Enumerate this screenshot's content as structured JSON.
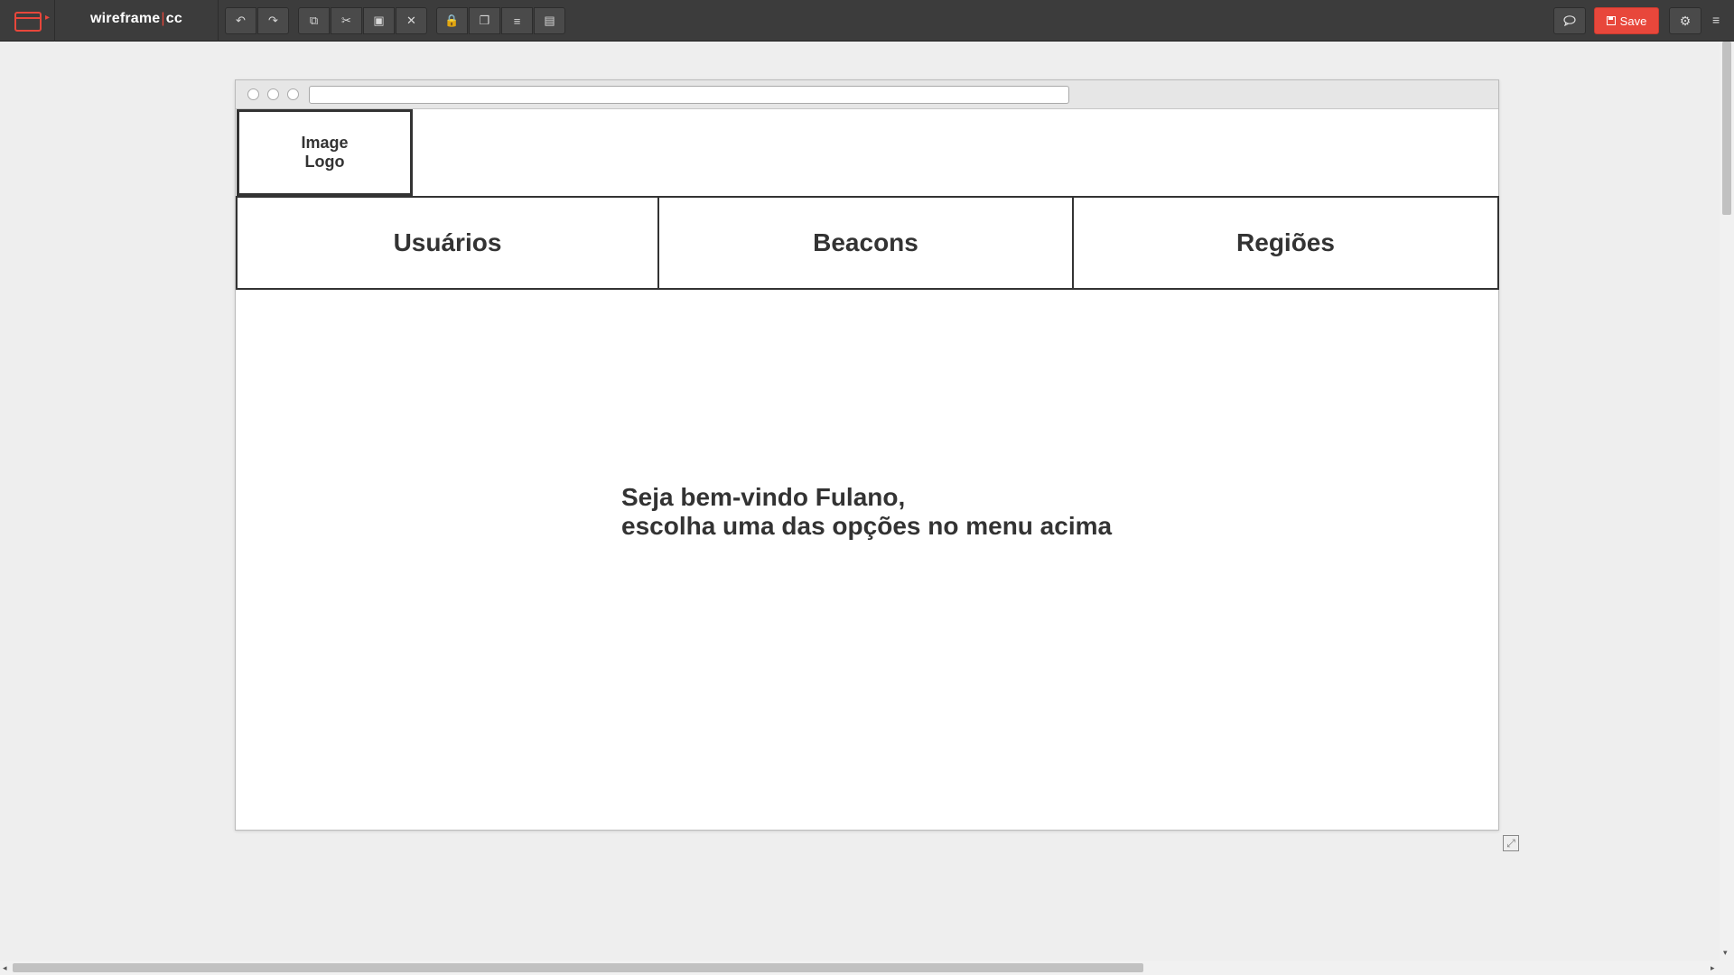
{
  "app": {
    "logo_main": "wireframe",
    "logo_sep": "|",
    "logo_suffix": "cc"
  },
  "toolbar": {
    "history_buttons": [
      {
        "name": "undo-button",
        "icon": "undo-icon",
        "glyph": "↶"
      },
      {
        "name": "redo-button",
        "icon": "redo-icon",
        "glyph": "↷"
      }
    ],
    "edit_buttons": [
      {
        "name": "copy-button",
        "icon": "copy-icon",
        "glyph": "⧉"
      },
      {
        "name": "cut-button",
        "icon": "scissors-icon",
        "glyph": "✂"
      },
      {
        "name": "paste-button",
        "icon": "paste-icon",
        "glyph": "▣"
      },
      {
        "name": "delete-button",
        "icon": "close-icon",
        "glyph": "✕"
      }
    ],
    "arrange_buttons": [
      {
        "name": "lock-button",
        "icon": "lock-icon",
        "glyph": "🔒"
      },
      {
        "name": "bring-front-button",
        "icon": "layers-icon",
        "glyph": "❐"
      },
      {
        "name": "align-button",
        "icon": "align-icon",
        "glyph": "≡"
      },
      {
        "name": "group-button",
        "icon": "group-icon",
        "glyph": "▤"
      }
    ],
    "save_label": "Save",
    "comment_icon": "comment-icon",
    "settings_icon": "gear-icon"
  },
  "wireframe": {
    "logo_line1": "Image",
    "logo_line2": "Logo",
    "nav": [
      "Usuários",
      "Beacons",
      "Regiões"
    ],
    "welcome_line1": "Seja bem-vindo Fulano,",
    "welcome_line2": "escolha uma das opções no menu acima"
  },
  "colors": {
    "accent": "#e8473b",
    "topbar": "#3c3c3c",
    "canvas": "#eeeeee"
  }
}
